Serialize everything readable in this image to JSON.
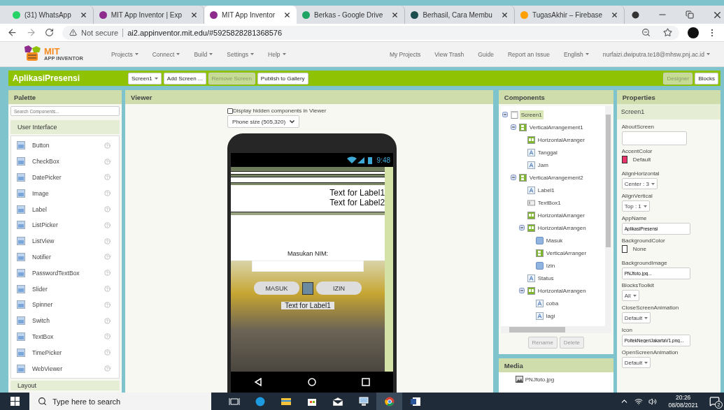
{
  "browser": {
    "tabs": [
      {
        "title": "(31) WhatsApp",
        "color": "#25d366",
        "selected": false
      },
      {
        "title": "MIT App Inventor | Exp",
        "color": "#8e2c8e",
        "selected": false
      },
      {
        "title": "MIT App Inventor",
        "color": "#8e2c8e",
        "selected": true
      },
      {
        "title": "Berkas - Google Drive",
        "color": "#1fa463",
        "selected": false
      },
      {
        "title": "Berhasil, Cara Membu",
        "color": "#1b4d4d",
        "selected": false
      },
      {
        "title": "TugasAkhir – Firebase",
        "color": "#ffa000",
        "selected": false
      }
    ],
    "warning": "Not secure",
    "url": "ai2.appinventor.mit.edu/#5925828281368576"
  },
  "header": {
    "logo_title": "MIT",
    "logo_subtitle": "APP INVENTOR",
    "menus": [
      {
        "label": "Projects",
        "dropdown": true
      },
      {
        "label": "Connect",
        "dropdown": true
      },
      {
        "label": "Build",
        "dropdown": true
      },
      {
        "label": "Settings",
        "dropdown": true
      },
      {
        "label": "Help",
        "dropdown": true
      }
    ],
    "links": [
      {
        "label": "My Projects",
        "dropdown": false
      },
      {
        "label": "View Trash",
        "dropdown": false
      },
      {
        "label": "Guide",
        "dropdown": false
      },
      {
        "label": "Report an Issue",
        "dropdown": false
      },
      {
        "label": "English",
        "dropdown": true
      },
      {
        "label": "nurfaizi.dwiputra.te18@mhsw.pnj.ac.id",
        "dropdown": true
      }
    ]
  },
  "project": {
    "name": "AplikasiPresensi",
    "buttons": [
      {
        "label": "Screen1",
        "dropdown": true,
        "disabled": false
      },
      {
        "label": "Add Screen ...",
        "dropdown": false,
        "disabled": false
      },
      {
        "label": "Remove Screen",
        "dropdown": false,
        "disabled": true
      },
      {
        "label": "Publish to Gallery",
        "dropdown": false,
        "disabled": false
      }
    ],
    "views": [
      {
        "label": "Designer",
        "selected": true
      },
      {
        "label": "Blocks",
        "selected": false
      }
    ]
  },
  "palette": {
    "title": "Palette",
    "placeholder": "Search Components...",
    "category": "User Interface",
    "items": [
      {
        "name": "Button"
      },
      {
        "name": "CheckBox"
      },
      {
        "name": "DatePicker"
      },
      {
        "name": "Image"
      },
      {
        "name": "Label"
      },
      {
        "name": "ListPicker"
      },
      {
        "name": "ListView"
      },
      {
        "name": "Notifier"
      },
      {
        "name": "PasswordTextBox"
      },
      {
        "name": "Slider"
      },
      {
        "name": "Spinner"
      },
      {
        "name": "Switch"
      },
      {
        "name": "TextBox"
      },
      {
        "name": "TimePicker"
      },
      {
        "name": "WebViewer"
      }
    ],
    "next_category": "Layout"
  },
  "viewer": {
    "title": "Viewer",
    "hidden_toggle": {
      "label": "Display hidden components in Viewer",
      "checked": false
    },
    "size": "Phone size (505,320)",
    "phone": {
      "time": "9:48",
      "label_1": "Text for Label1",
      "label_2": "Text for Label2",
      "prompt": "Masukan NIM:",
      "buttons": [
        "MASUK",
        "IZIN"
      ],
      "status_label": "Text for Label1"
    }
  },
  "components": {
    "title": "Components",
    "tree": [
      {
        "name": "Screen1",
        "kind": "screen",
        "selected": true,
        "expanded": true,
        "children": [
          {
            "name": "VerticalArrangement1",
            "kind": "vertical",
            "selected": false,
            "expanded": true,
            "children": [
              {
                "name": "HorizontalArranger",
                "kind": "horizontal",
                "selected": false
              },
              {
                "name": "Tanggal",
                "kind": "label",
                "selected": false
              },
              {
                "name": "Jam",
                "kind": "label",
                "selected": false
              }
            ]
          },
          {
            "name": "VerticalArrangement2",
            "kind": "vertical",
            "selected": false,
            "expanded": true,
            "children": [
              {
                "name": "Label1",
                "kind": "label",
                "selected": false
              },
              {
                "name": "TextBox1",
                "kind": "textbox",
                "selected": false
              },
              {
                "name": "HorizontalArranger",
                "kind": "horizontal",
                "selected": false
              },
              {
                "name": "HorizontalArrangen",
                "kind": "horizontal",
                "selected": false,
                "expanded": true,
                "children": [
                  {
                    "name": "Masuk",
                    "kind": "button",
                    "selected": false
                  },
                  {
                    "name": "VerticalArranger",
                    "kind": "vertical",
                    "selected": false
                  },
                  {
                    "name": "Izin",
                    "kind": "button",
                    "selected": false
                  }
                ]
              },
              {
                "name": "Status",
                "kind": "label",
                "selected": false
              },
              {
                "name": "HorizontalArrangen",
                "kind": "horizontal",
                "selected": false,
                "expanded": true,
                "children": [
                  {
                    "name": "coba",
                    "kind": "label",
                    "selected": false
                  },
                  {
                    "name": "lagi",
                    "kind": "label",
                    "selected": false
                  }
                ]
              }
            ]
          }
        ]
      }
    ],
    "buttons": [
      {
        "label": "Rename",
        "disabled": true
      },
      {
        "label": "Delete",
        "disabled": true
      }
    ]
  },
  "media": {
    "title": "Media",
    "files": [
      "PNJfoto.jpg"
    ]
  },
  "properties": {
    "title": "Properties",
    "component": "Screen1",
    "items": [
      {
        "name": "AboutScreen",
        "kind": "textarea"
      },
      {
        "name": "AccentColor",
        "kind": "color",
        "color": "#e8336b",
        "value": "Default"
      },
      {
        "name": "AlignHorizontal",
        "kind": "select",
        "value": "Center : 3"
      },
      {
        "name": "AlignVertical",
        "kind": "select",
        "value": "Top : 1"
      },
      {
        "name": "AppName",
        "kind": "text",
        "value": "AplikasiPresensi"
      },
      {
        "name": "BackgroundColor",
        "kind": "color",
        "color": "#ffffff",
        "value": "None"
      },
      {
        "name": "BackgroundImage",
        "kind": "text",
        "value": "PNJfoto.jpg..."
      },
      {
        "name": "BlocksToolkit",
        "kind": "select",
        "value": "All"
      },
      {
        "name": "CloseScreenAnimation",
        "kind": "select",
        "value": "Default"
      },
      {
        "name": "Icon",
        "kind": "text",
        "value": "PoltekNegeriJakartaV1.png..."
      },
      {
        "name": "OpenScreenAnimation",
        "kind": "select",
        "value": "Default"
      }
    ]
  },
  "taskbar": {
    "placeholder": "Type here to search",
    "apps": [
      {
        "kind": "taskview",
        "active": false
      },
      {
        "kind": "edge",
        "active": false
      },
      {
        "kind": "explorer",
        "active": false
      },
      {
        "kind": "store",
        "active": false
      },
      {
        "kind": "mail",
        "active": false
      },
      {
        "kind": "network",
        "active": false
      },
      {
        "kind": "chrome",
        "active": true
      },
      {
        "kind": "word",
        "active": false
      }
    ],
    "time": "20:26",
    "date": "08/08/2021",
    "notifications": "2"
  }
}
